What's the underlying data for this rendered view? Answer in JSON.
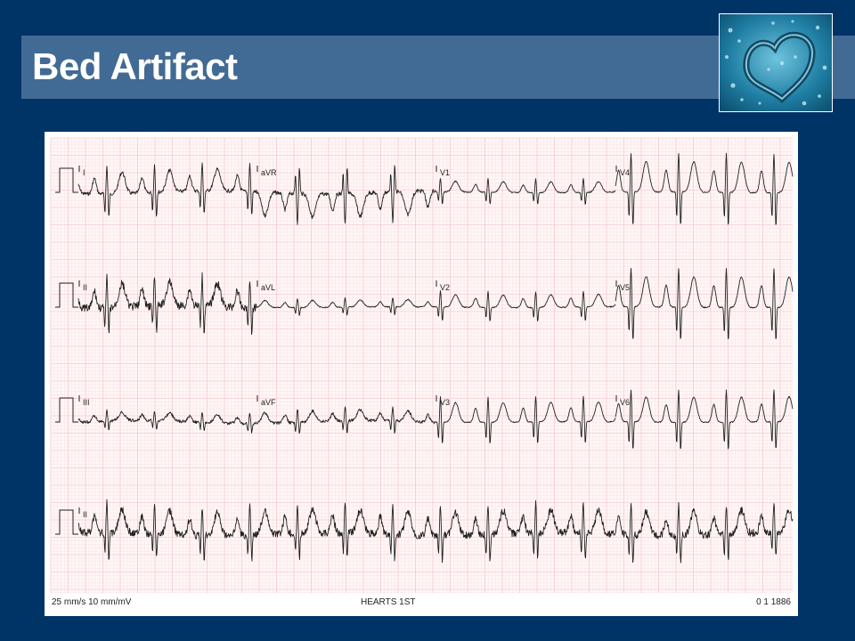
{
  "slide": {
    "title": "Bed Artifact",
    "background_color": "#003366",
    "title_bar_color": "#416b95"
  },
  "logo": {
    "icon": "water-droplets-heart-icon"
  },
  "ecg": {
    "rows": [
      {
        "leads": [
          "I",
          "aVR",
          "V1",
          "V4"
        ]
      },
      {
        "leads": [
          "II",
          "aVL",
          "V2",
          "V5"
        ]
      },
      {
        "leads": [
          "III",
          "aVF",
          "V3",
          "V6"
        ]
      },
      {
        "leads": [
          "II"
        ]
      }
    ],
    "footer": {
      "speed_gain": "25 mm/s  10 mm/mV",
      "center": "HEARTS 1ST",
      "right": "0 1 1886"
    },
    "grid_minor_color": "#fbe3e3",
    "grid_major_color": "#f4baba",
    "trace_color": "#222222"
  }
}
